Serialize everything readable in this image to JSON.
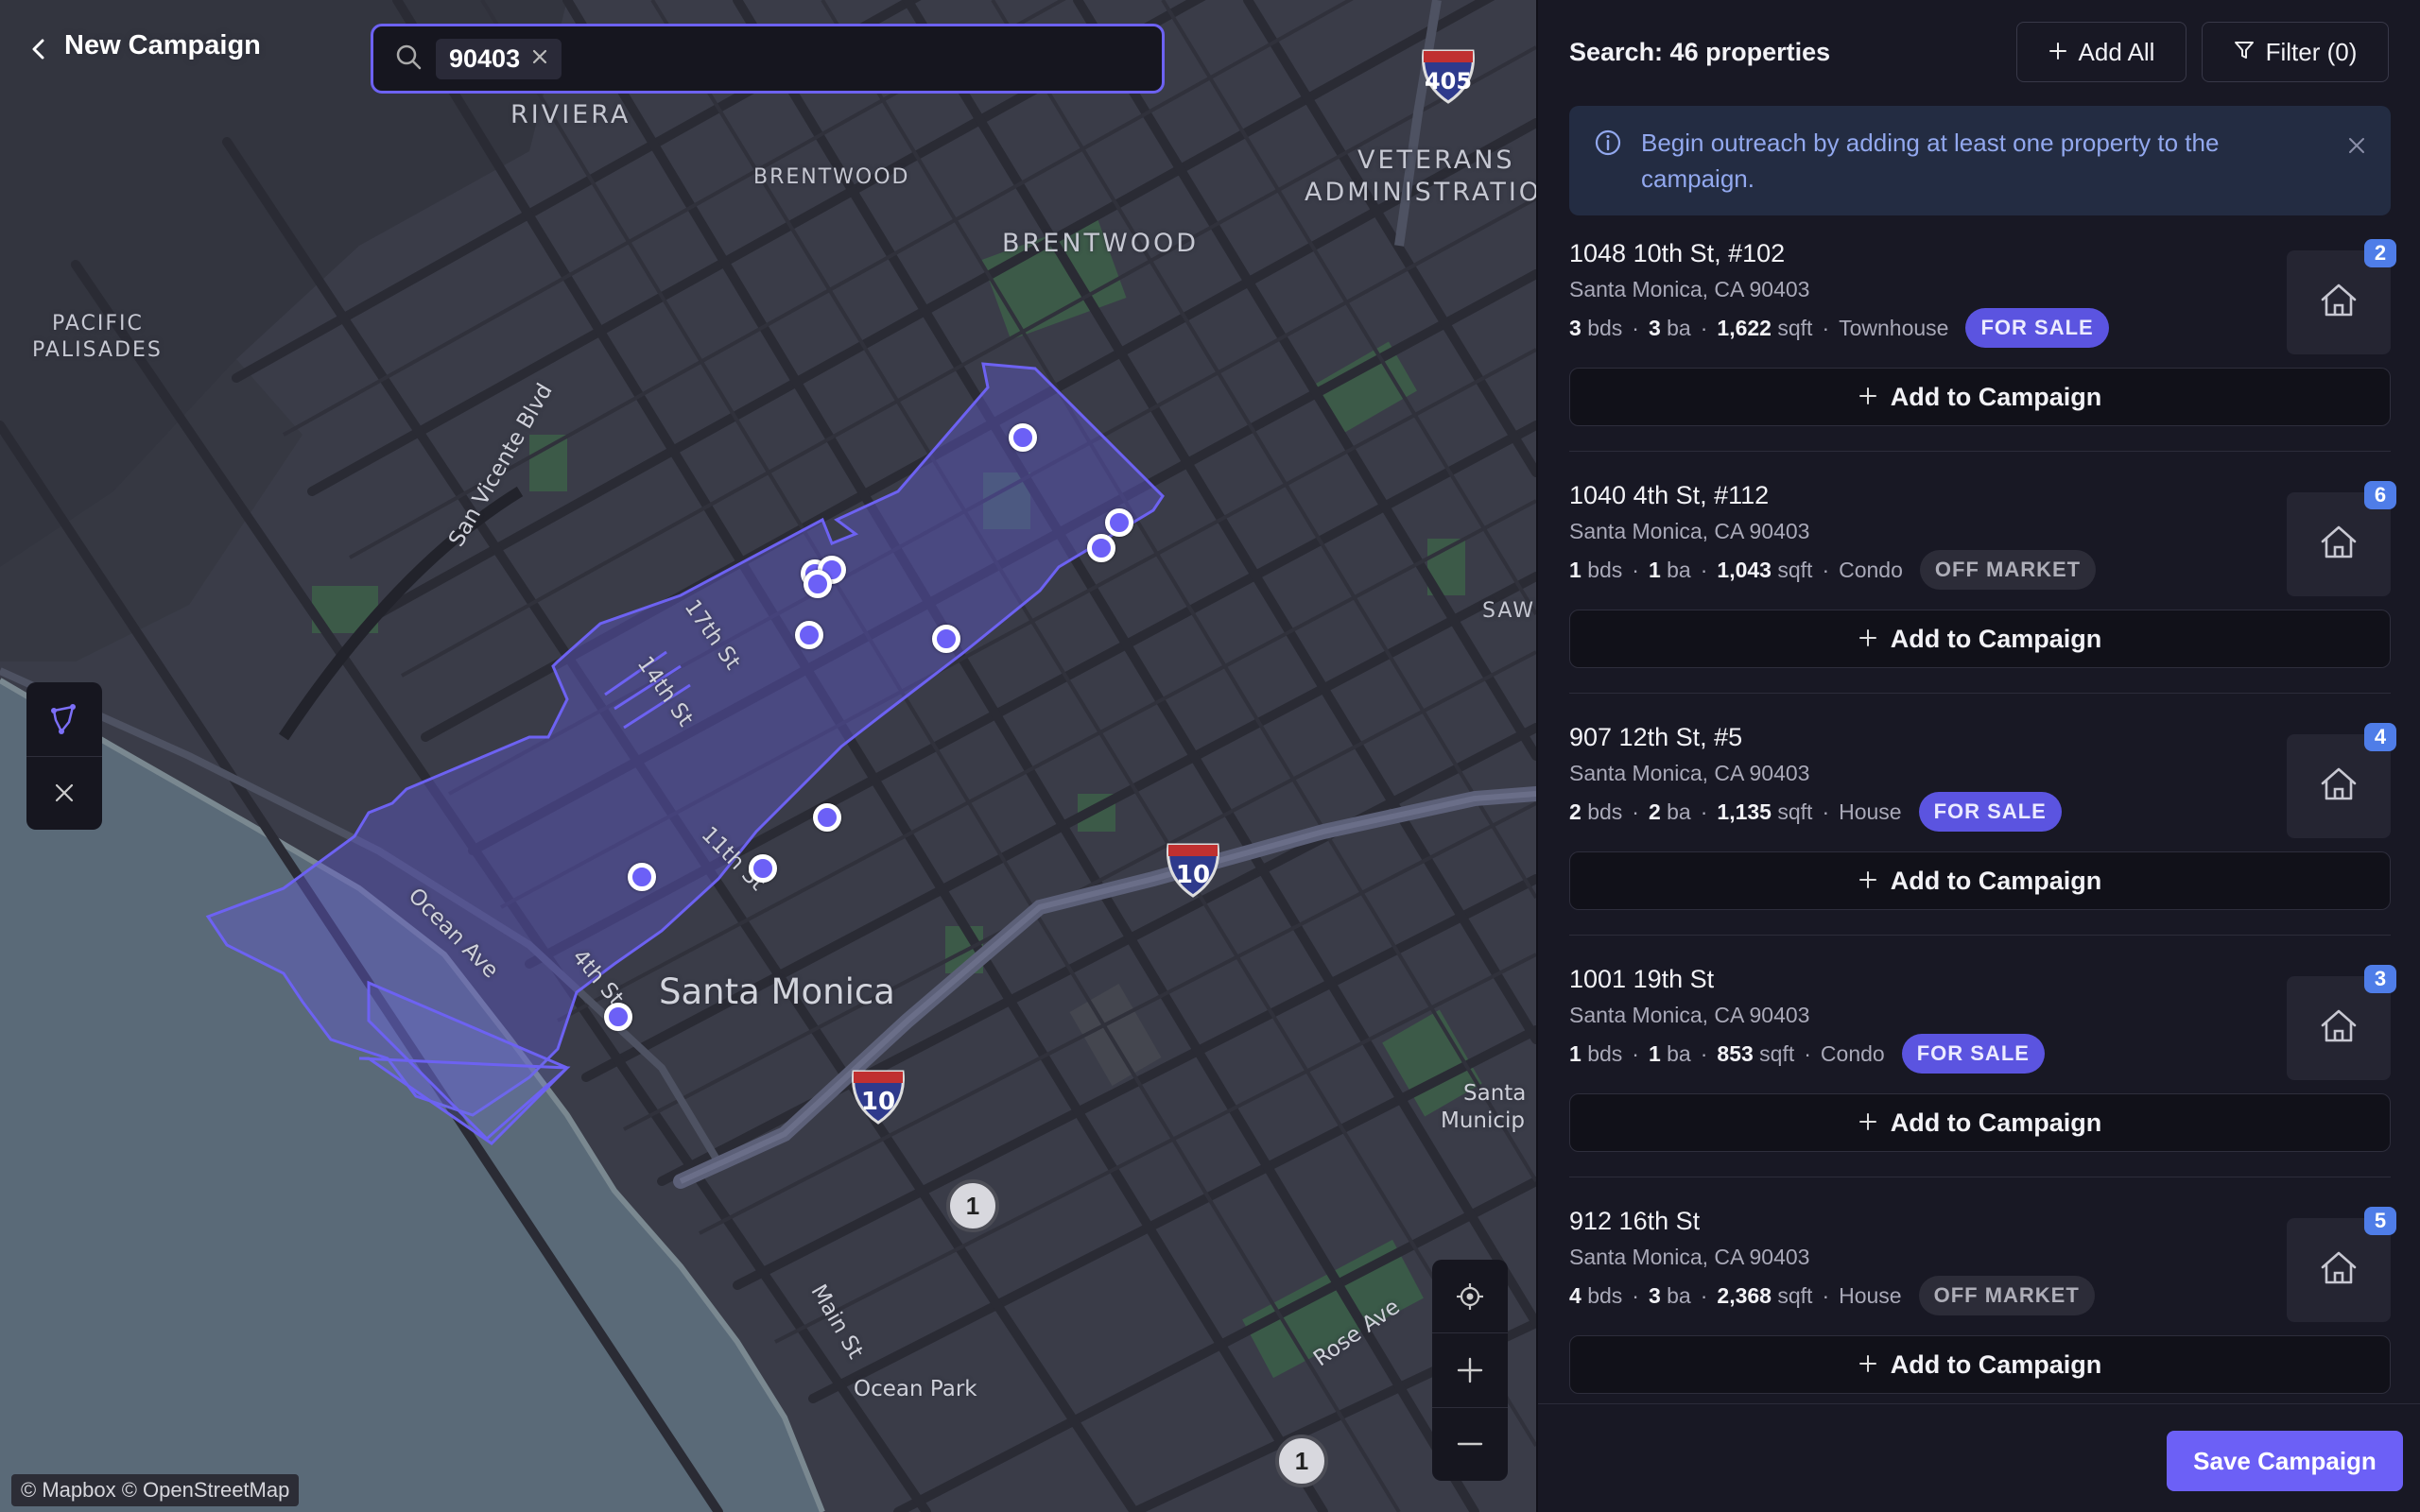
{
  "header": {
    "back_icon": "chevron-left-icon",
    "title": "New Campaign"
  },
  "search": {
    "icon": "search-icon",
    "chip_value": "90403",
    "chip_remove_icon": "close-icon"
  },
  "map": {
    "labels": {
      "riviera": "RIVIERA",
      "brentwood_small": "BRENTWOOD",
      "brentwood": "BRENTWOOD",
      "pacific": "PACIFIC",
      "palisades": "PALISADES",
      "veterans": "VETERANS",
      "administration": "ADMINISTRATIO",
      "saw": "SAW",
      "santa_monica": "Santa Monica",
      "ocean_park": "Ocean Park",
      "santa": "Santa",
      "municip": "Municip"
    },
    "streets": {
      "san_vicente": "San Vicente Blvd",
      "st17": "17th St",
      "st14": "14th St",
      "st11": "11th St",
      "st4": "4th St",
      "ocean_ave": "Ocean Ave",
      "main_st": "Main St",
      "rose_ave": "Rose Ave"
    },
    "highways": {
      "i405": "405",
      "i10a": "10",
      "i10b": "10"
    },
    "clusters": [
      "1",
      "1"
    ],
    "attribution": "© Mapbox © OpenStreetMap",
    "controls": {
      "draw_icon": "polygon-draw-icon",
      "clear_icon": "close-icon",
      "locate_icon": "locate-icon",
      "zoom_in_icon": "plus-icon",
      "zoom_out_icon": "minus-icon"
    },
    "colors": {
      "boundary": "#6d62f2",
      "marker": "#6c60f6"
    }
  },
  "panel": {
    "title": "Search: 46 properties",
    "add_all_label": "Add All",
    "filter_label": "Filter (0)",
    "alert": {
      "icon": "info-icon",
      "text": "Begin outreach by adding at least one property to the campaign.",
      "close_icon": "close-icon"
    },
    "listings": [
      {
        "address": "1048 10th St, #102",
        "city": "Santa Monica, CA 90403",
        "beds": "3",
        "beds_unit": "bds",
        "baths": "3",
        "baths_unit": "ba",
        "sqft": "1,622",
        "sqft_unit": "sqft",
        "type": "Townhouse",
        "status": "FOR SALE",
        "count": "2",
        "add_label": "Add to Campaign"
      },
      {
        "address": "1040 4th St, #112",
        "city": "Santa Monica, CA 90403",
        "beds": "1",
        "beds_unit": "bds",
        "baths": "1",
        "baths_unit": "ba",
        "sqft": "1,043",
        "sqft_unit": "sqft",
        "type": "Condo",
        "status": "OFF MARKET",
        "count": "6",
        "add_label": "Add to Campaign"
      },
      {
        "address": "907 12th St, #5",
        "city": "Santa Monica, CA 90403",
        "beds": "2",
        "beds_unit": "bds",
        "baths": "2",
        "baths_unit": "ba",
        "sqft": "1,135",
        "sqft_unit": "sqft",
        "type": "House",
        "status": "FOR SALE",
        "count": "4",
        "add_label": "Add to Campaign"
      },
      {
        "address": "1001 19th St",
        "city": "Santa Monica, CA 90403",
        "beds": "1",
        "beds_unit": "bds",
        "baths": "1",
        "baths_unit": "ba",
        "sqft": "853",
        "sqft_unit": "sqft",
        "type": "Condo",
        "status": "FOR SALE",
        "count": "3",
        "add_label": "Add to Campaign"
      },
      {
        "address": "912 16th St",
        "city": "Santa Monica, CA 90403",
        "beds": "4",
        "beds_unit": "bds",
        "baths": "3",
        "baths_unit": "ba",
        "sqft": "2,368",
        "sqft_unit": "sqft",
        "type": "House",
        "status": "OFF MARKET",
        "count": "5",
        "add_label": "Add to Campaign"
      }
    ],
    "save_label": "Save Campaign",
    "colors": {
      "accent": "#6c60f6",
      "for_sale": "#5b54e0",
      "count_badge": "#4f7de8"
    }
  }
}
